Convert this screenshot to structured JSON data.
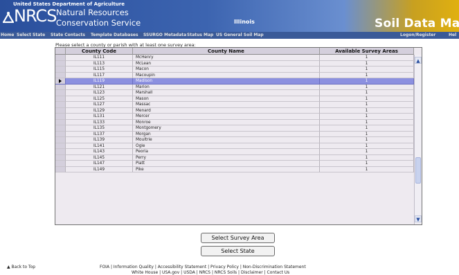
{
  "header": {
    "agency": "United States Department of Agriculture",
    "logo_text": "NRCS",
    "logo_line1": "Natural Resources",
    "logo_line2": "Conservation Service",
    "state": "Illinois",
    "app_title": "Soil Data Mar"
  },
  "nav": {
    "items": [
      "Home",
      "Select State",
      "State Contacts",
      "Template Databases",
      "SSURGO Metadata",
      "Status Map",
      "US General Soil Map"
    ],
    "right_items": [
      "Logon/Register",
      "Hel"
    ]
  },
  "main": {
    "prompt": "Please select a county or parish with at least one survey area:",
    "columns": [
      "County Code",
      "County Name",
      "Available Survey Areas"
    ],
    "rows": [
      {
        "code": "IL111",
        "name": "McHenry",
        "areas": "1"
      },
      {
        "code": "IL113",
        "name": "McLean",
        "areas": "1"
      },
      {
        "code": "IL115",
        "name": "Macon",
        "areas": "1"
      },
      {
        "code": "IL117",
        "name": "Macoupin",
        "areas": "1"
      },
      {
        "code": "IL119",
        "name": "Madison",
        "areas": "1"
      },
      {
        "code": "IL121",
        "name": "Marion",
        "areas": "1"
      },
      {
        "code": "IL123",
        "name": "Marshall",
        "areas": "1"
      },
      {
        "code": "IL125",
        "name": "Mason",
        "areas": "1"
      },
      {
        "code": "IL127",
        "name": "Massac",
        "areas": "1"
      },
      {
        "code": "IL129",
        "name": "Menard",
        "areas": "1"
      },
      {
        "code": "IL131",
        "name": "Mercer",
        "areas": "1"
      },
      {
        "code": "IL133",
        "name": "Monroe",
        "areas": "1"
      },
      {
        "code": "IL135",
        "name": "Montgomery",
        "areas": "1"
      },
      {
        "code": "IL137",
        "name": "Morgan",
        "areas": "1"
      },
      {
        "code": "IL139",
        "name": "Moultrie",
        "areas": "1"
      },
      {
        "code": "IL141",
        "name": "Ogle",
        "areas": "1"
      },
      {
        "code": "IL143",
        "name": "Peoria",
        "areas": "1"
      },
      {
        "code": "IL145",
        "name": "Perry",
        "areas": "1"
      },
      {
        "code": "IL147",
        "name": "Piatt",
        "areas": "1"
      },
      {
        "code": "IL149",
        "name": "Pike",
        "areas": "1"
      }
    ],
    "selected_row_index": 4,
    "select_survey_area_label": "Select Survey Area",
    "select_state_label": "Select State"
  },
  "footer": {
    "back_to_top": "▲ Back to Top",
    "line1": "FOIA | Information Quality | Accessibility Statement | Privacy Policy | Non-Discrimination Statement",
    "line2": "White House | USA.gov | USDA | NRCS | NRCS Soils | Disclaimer | Contact Us"
  },
  "icons": {
    "scroll_up": "chevron-up-icon",
    "scroll_down": "chevron-down-icon",
    "row_pointer": "row-pointer-icon"
  },
  "colors": {
    "header_blue": "#2a4f9c",
    "nav_bar": "#3a5a98",
    "selected_row": "#8c90e0",
    "grid_background": "#eeeaf0",
    "header_cell": "#d4cfdc"
  }
}
